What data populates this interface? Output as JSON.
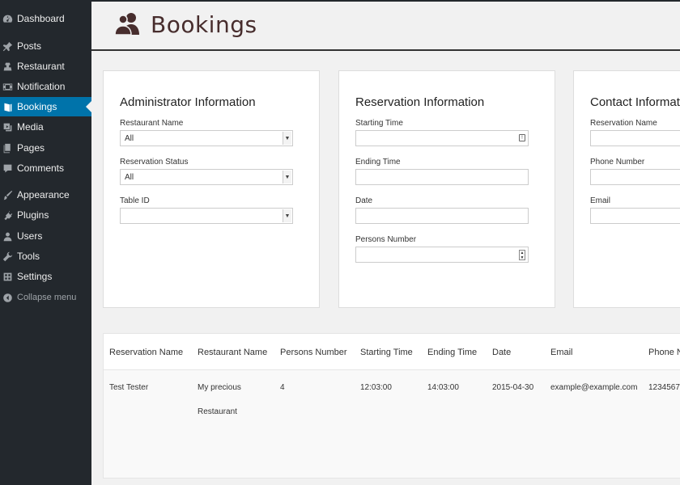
{
  "sidebar": {
    "items": [
      {
        "label": "Dashboard",
        "icon": "dashboard-icon"
      },
      {
        "label": "Posts",
        "icon": "pin-icon"
      },
      {
        "label": "Restaurant",
        "icon": "chef-icon"
      },
      {
        "label": "Notification",
        "icon": "film-icon"
      },
      {
        "label": "Bookings",
        "icon": "book-icon",
        "active": true
      },
      {
        "label": "Media",
        "icon": "media-icon"
      },
      {
        "label": "Pages",
        "icon": "pages-icon"
      },
      {
        "label": "Comments",
        "icon": "comment-icon"
      },
      {
        "label": "Appearance",
        "icon": "brush-icon"
      },
      {
        "label": "Plugins",
        "icon": "plugin-icon"
      },
      {
        "label": "Users",
        "icon": "users-icon"
      },
      {
        "label": "Tools",
        "icon": "wrench-icon"
      },
      {
        "label": "Settings",
        "icon": "settings-icon"
      }
    ],
    "collapse_label": "Collapse menu"
  },
  "header": {
    "title": "Bookings",
    "icon": "users-icon"
  },
  "panels": {
    "admin": {
      "title": "Administrator Information",
      "restaurant_name_label": "Restaurant Name",
      "restaurant_name_value": "All",
      "reservation_status_label": "Reservation Status",
      "reservation_status_value": "All",
      "table_id_label": "Table ID",
      "table_id_value": ""
    },
    "reservation": {
      "title": "Reservation Information",
      "starting_time_label": "Starting Time",
      "ending_time_label": "Ending Time",
      "date_label": "Date",
      "persons_number_label": "Persons Number"
    },
    "contact": {
      "title": "Contact Information",
      "reservation_name_label": "Reservation Name",
      "phone_number_label": "Phone Number",
      "email_label": "Email"
    }
  },
  "table": {
    "columns": [
      "Reservation Name",
      "Restaurant Name",
      "Persons Number",
      "Starting Time",
      "Ending Time",
      "Date",
      "Email",
      "Phone N"
    ],
    "rows": [
      {
        "reservation_name": "Test Tester",
        "restaurant_name_line1": "My precious",
        "restaurant_name_line2": "Restaurant",
        "persons_number": "4",
        "starting_time": "12:03:00",
        "ending_time": "14:03:00",
        "date": "2015-04-30",
        "email": "example@example.com",
        "phone": "1234567"
      }
    ]
  },
  "colors": {
    "sidebar_bg": "#23282d",
    "active_bg": "#0073aa",
    "title": "#472d2d"
  }
}
